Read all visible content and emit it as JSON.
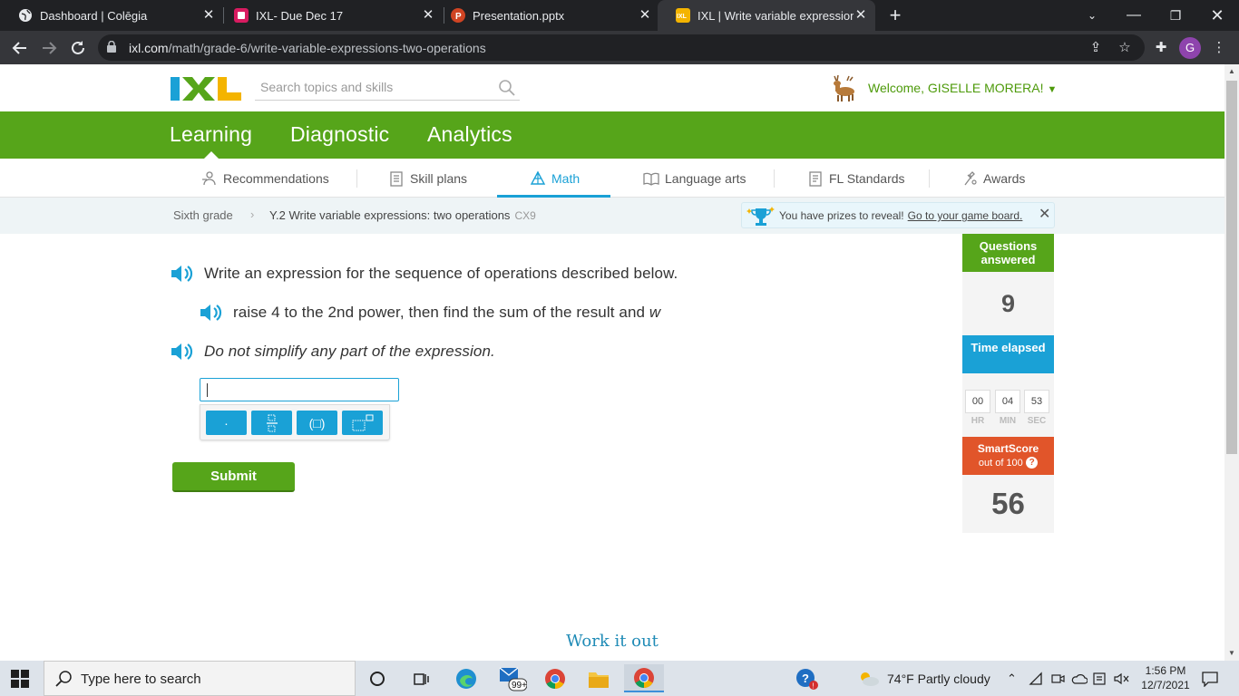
{
  "browser": {
    "tabs": [
      {
        "title": "Dashboard | Colēgia",
        "icon_color": "#e8eaed",
        "active": false
      },
      {
        "title": "IXL- Due Dec 17",
        "icon_color": "#d81b60",
        "active": false
      },
      {
        "title": "Presentation.pptx",
        "icon_color": "#d04423",
        "active": false
      },
      {
        "title": "IXL | Write variable expressions: t",
        "icon_color": "#f4b400",
        "active": true
      }
    ],
    "url_host": "ixl.com",
    "url_path": "/math/grade-6/write-variable-expressions-two-operations",
    "profile_initial": "G"
  },
  "header": {
    "search_placeholder": "Search topics and skills",
    "welcome": "Welcome, GISELLE MORERA!"
  },
  "main_nav": [
    "Learning",
    "Diagnostic",
    "Analytics"
  ],
  "sub_nav": [
    {
      "label": "Recommendations",
      "icon": "recommendations-icon"
    },
    {
      "label": "Skill plans",
      "icon": "skill-plans-icon"
    },
    {
      "label": "Math",
      "icon": "math-icon",
      "active": true
    },
    {
      "label": "Language arts",
      "icon": "book-icon"
    },
    {
      "label": "FL Standards",
      "icon": "standards-icon"
    },
    {
      "label": "Awards",
      "icon": "awards-icon"
    }
  ],
  "breadcrumb": {
    "grade": "Sixth grade",
    "skill": "Y.2 Write variable expressions: two operations",
    "code": "CX9"
  },
  "prize_banner": {
    "text": "You have prizes to reveal!",
    "link": "Go to your game board."
  },
  "question": {
    "instruction": "Write an expression for the sequence of operations described below.",
    "prompt": "raise 4 to the 2nd power, then find the sum of the result and",
    "variable": "w",
    "note": "Do not simplify any part of the expression."
  },
  "math_toolbar": {
    "buttons": [
      "·",
      "fraction",
      "( )",
      "exponent"
    ],
    "dot_label": "·",
    "paren_label": "(□)"
  },
  "submit_label": "Submit",
  "work_it_out": "Work it out",
  "stats": {
    "questions_label": "Questions answered",
    "questions_value": "9",
    "time_label": "Time elapsed",
    "hr": "00",
    "min": "04",
    "sec": "53",
    "hr_label": "HR",
    "min_label": "MIN",
    "sec_label": "SEC",
    "smartscore_label": "SmartScore",
    "smartscore_sub": "out of 100",
    "smartscore_value": "56"
  },
  "taskbar": {
    "search_placeholder": "Type here to search",
    "mail_badge": "99+",
    "weather": "74°F  Partly cloudy",
    "time": "1:56 PM",
    "date": "12/7/2021"
  },
  "colors": {
    "ixl_green": "#56a51a",
    "ixl_blue": "#1aa1d6",
    "smartscore_orange": "#e1552a"
  }
}
